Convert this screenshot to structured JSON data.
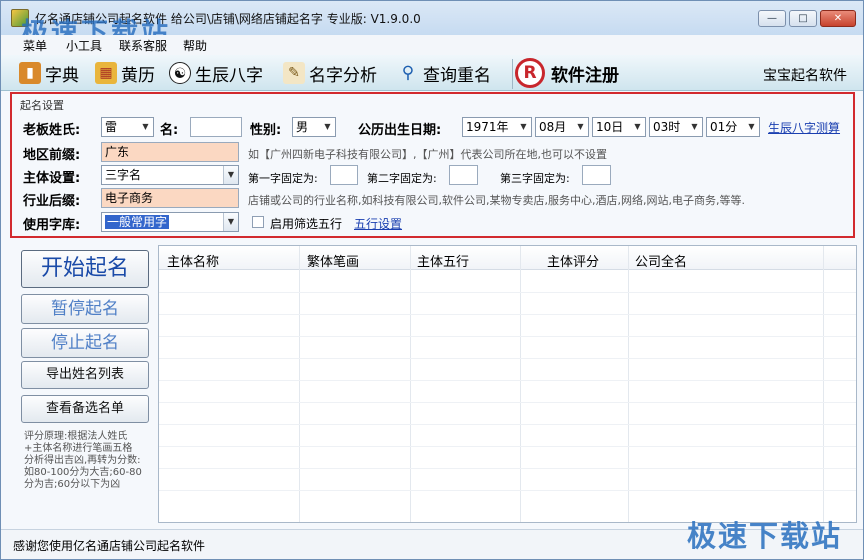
{
  "window": {
    "title": "亿名通店铺公司起名软件 给公司\\店铺\\网络店铺起名字  专业版: V1.9.0.0",
    "watermark": "极速下载站",
    "controls": {
      "minimize": "—",
      "maximize": "□",
      "close": "✕"
    }
  },
  "menu": [
    "菜单",
    "小工具",
    "联系客服",
    "帮助"
  ],
  "toolbar": {
    "items": [
      {
        "label": "字典",
        "icon": "book-icon"
      },
      {
        "label": "黄历",
        "icon": "calendar-icon"
      },
      {
        "label": "生辰八字",
        "icon": "yin-yang-icon"
      },
      {
        "label": "名字分析",
        "icon": "clipboard-icon"
      },
      {
        "label": "查询重名",
        "icon": "magnifier-icon"
      }
    ],
    "register": {
      "label": "软件注册",
      "icon_text": "R"
    },
    "baby_naming": "宝宝起名软件"
  },
  "settings": {
    "legend": "起名设置",
    "surname_label": "老板姓氏:",
    "surname_value": "雷",
    "name_label": "名:",
    "gender_label": "性别:",
    "gender_value": "男",
    "birth_label": "公历出生日期:",
    "birth_year": "1971年",
    "birth_month": "08月",
    "birth_day": "10日",
    "birth_hour": "03时",
    "birth_minute": "01分",
    "bazi_link": "生辰八字测算",
    "region_label": "地区前缀:",
    "region_value": "广东",
    "region_hint": "如【广州四新电子科技有限公司】,【广州】代表公司所在地,也可以不设置",
    "subject_label": "主体设置:",
    "subject_value": "三字名",
    "first_fixed": "第一字固定为:",
    "second_fixed": "第二字固定为:",
    "third_fixed": "第三字固定为:",
    "industry_label": "行业后缀:",
    "industry_value": "电子商务",
    "industry_hint": "店铺或公司的行业名称,如科技有限公司,软件公司,某物专卖店,服务中心,酒店,网络,网站,电子商务,等等.",
    "charset_label": "使用字库:",
    "charset_value": "一般常用字",
    "wuxing_filter": "启用筛选五行",
    "wuxing_link": "五行设置"
  },
  "actions": {
    "start": "开始起名",
    "pause": "暂停起名",
    "stop": "停止起名",
    "export": "导出姓名列表",
    "view": "查看备选名单"
  },
  "principle": "评分原理:根据法人姓氏+主体名称进行笔画五格分析得出吉凶,再转为分数:如80-100分为大吉;60-80分为吉;60分以下为凶",
  "table": {
    "columns": [
      "主体名称",
      "繁体笔画",
      "主体五行",
      "主体评分",
      "公司全名"
    ]
  },
  "status": "感谢您使用亿名通店铺公司起名软件"
}
